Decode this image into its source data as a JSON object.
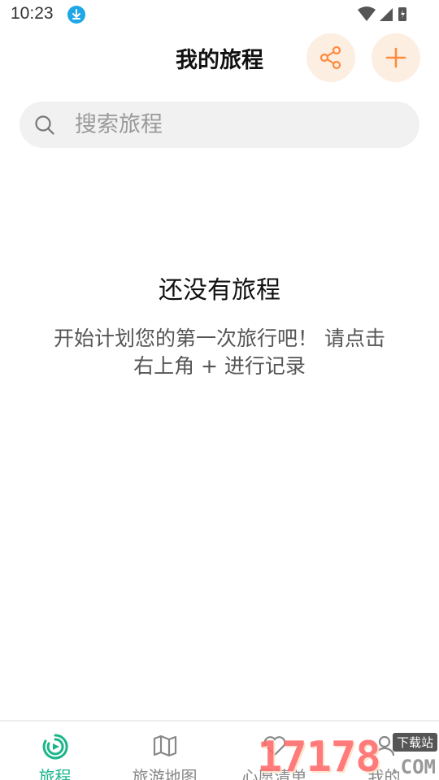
{
  "status_bar": {
    "time": "10:23"
  },
  "header": {
    "title": "我的旅程",
    "share_icon": "share-icon",
    "add_icon": "plus-icon",
    "accent": "#ff8a3d",
    "button_bg": "#fdeee2"
  },
  "search": {
    "placeholder": "搜索旅程"
  },
  "empty": {
    "title": "还没有旅程",
    "description": "开始计划您的第一次旅行吧！ 请点击右上角 + 进行记录"
  },
  "tabs": [
    {
      "label": "旅程",
      "icon": "journey-icon",
      "active": true
    },
    {
      "label": "旅游地图",
      "icon": "map-icon",
      "active": false
    },
    {
      "label": "心愿清单",
      "icon": "wishlist-icon",
      "active": false
    },
    {
      "label": "我的",
      "icon": "profile-icon",
      "active": false
    }
  ],
  "tab_active_color": "#1bb58a",
  "watermark": {
    "logo": "17178",
    "tag": "下载站",
    "suffix": ".COM"
  }
}
